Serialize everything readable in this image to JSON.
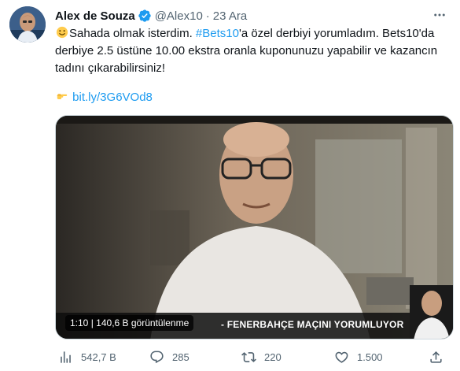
{
  "author": {
    "name": "Alex de Souza",
    "handle": "@Alex10",
    "separator": "·",
    "date": "23 Ara",
    "verified": true
  },
  "tweet": {
    "text_part1": "Sahada olmak isterdim. ",
    "hashtag": "#Bets10",
    "text_part2": "'a özel derbiyi yorumladım. Bets10'da derbiye 2.5 üstüne 10.00 ekstra oranla kuponunuzu yapabilir ve kazancın tadını çıkarabilirsiniz!",
    "link": "bit.ly/3G6VOd8"
  },
  "video": {
    "time": "1:10",
    "views": "140,6 B görüntülenme",
    "banner": "- FENERBAHÇE MAÇINI YORUMLUYOR"
  },
  "actions": {
    "views": "542,7 B",
    "replies": "285",
    "retweets": "220",
    "likes": "1.500"
  },
  "colors": {
    "accent": "#1d9bf0",
    "secondary_text": "#536471"
  }
}
